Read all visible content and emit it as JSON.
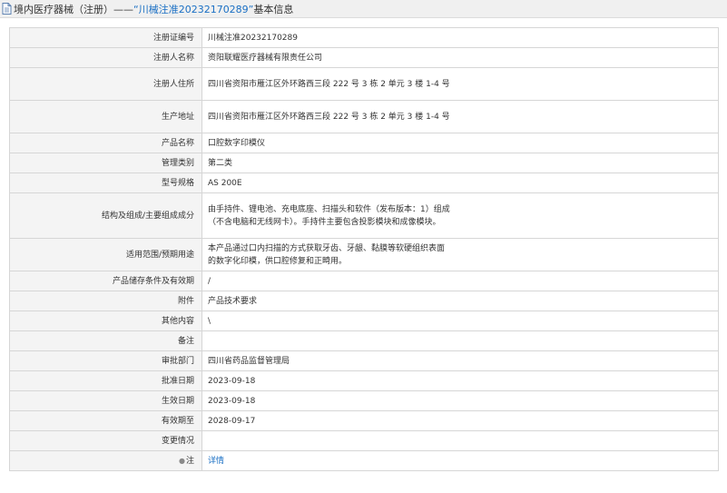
{
  "header": {
    "prefix": "境内医疗器械（注册）",
    "dash": "——",
    "highlight": "“川械注准20232170289”",
    "suffix": "基本信息"
  },
  "rows": [
    {
      "label": "注册证编号",
      "value": "川械注准20232170289"
    },
    {
      "label": "注册人名称",
      "value": "资阳联耀医疗器械有限责任公司"
    },
    {
      "label": "注册人住所",
      "value": "四川省资阳市雁江区外环路西三段 222 号 3 栋 2 单元 3 楼 1-4 号"
    },
    {
      "label": "生产地址",
      "value": "四川省资阳市雁江区外环路西三段 222 号 3 栋 2 单元 3 楼 1-4 号"
    },
    {
      "label": "产品名称",
      "value": "口腔数字印模仪"
    },
    {
      "label": "管理类别",
      "value": "第二类"
    },
    {
      "label": "型号规格",
      "value": "AS 200E"
    },
    {
      "label": "结构及组成/主要组成成分",
      "value": "由手持件、锂电池、充电底座、扫描头和软件（发布版本：1）组成（不含电脑和无线网卡）。手持件主要包含投影模块和成像模块。"
    },
    {
      "label": "适用范围/预期用途",
      "value": "本产品通过口内扫描的方式获取牙齿、牙龈、黏膜等软硬组织表面的数字化印模，供口腔修复和正畸用。"
    },
    {
      "label": "产品储存条件及有效期",
      "value": "/"
    },
    {
      "label": "附件",
      "value": "产品技术要求"
    },
    {
      "label": "其他内容",
      "value": "\\"
    },
    {
      "label": "备注",
      "value": ""
    },
    {
      "label": "审批部门",
      "value": "四川省药品监督管理局"
    },
    {
      "label": "批准日期",
      "value": "2023-09-18"
    },
    {
      "label": "生效日期",
      "value": "2023-09-18"
    },
    {
      "label": "有效期至",
      "value": "2028-09-17"
    },
    {
      "label": "变更情况",
      "value": ""
    }
  ],
  "note_row": {
    "label": "注",
    "icon": "info-icon",
    "link_text": "详情"
  },
  "colors": {
    "link": "#1a6fc4",
    "label_bg": "#f4f4f4",
    "border": "#d6d6d6",
    "title_bg": "#f0f0f0"
  }
}
